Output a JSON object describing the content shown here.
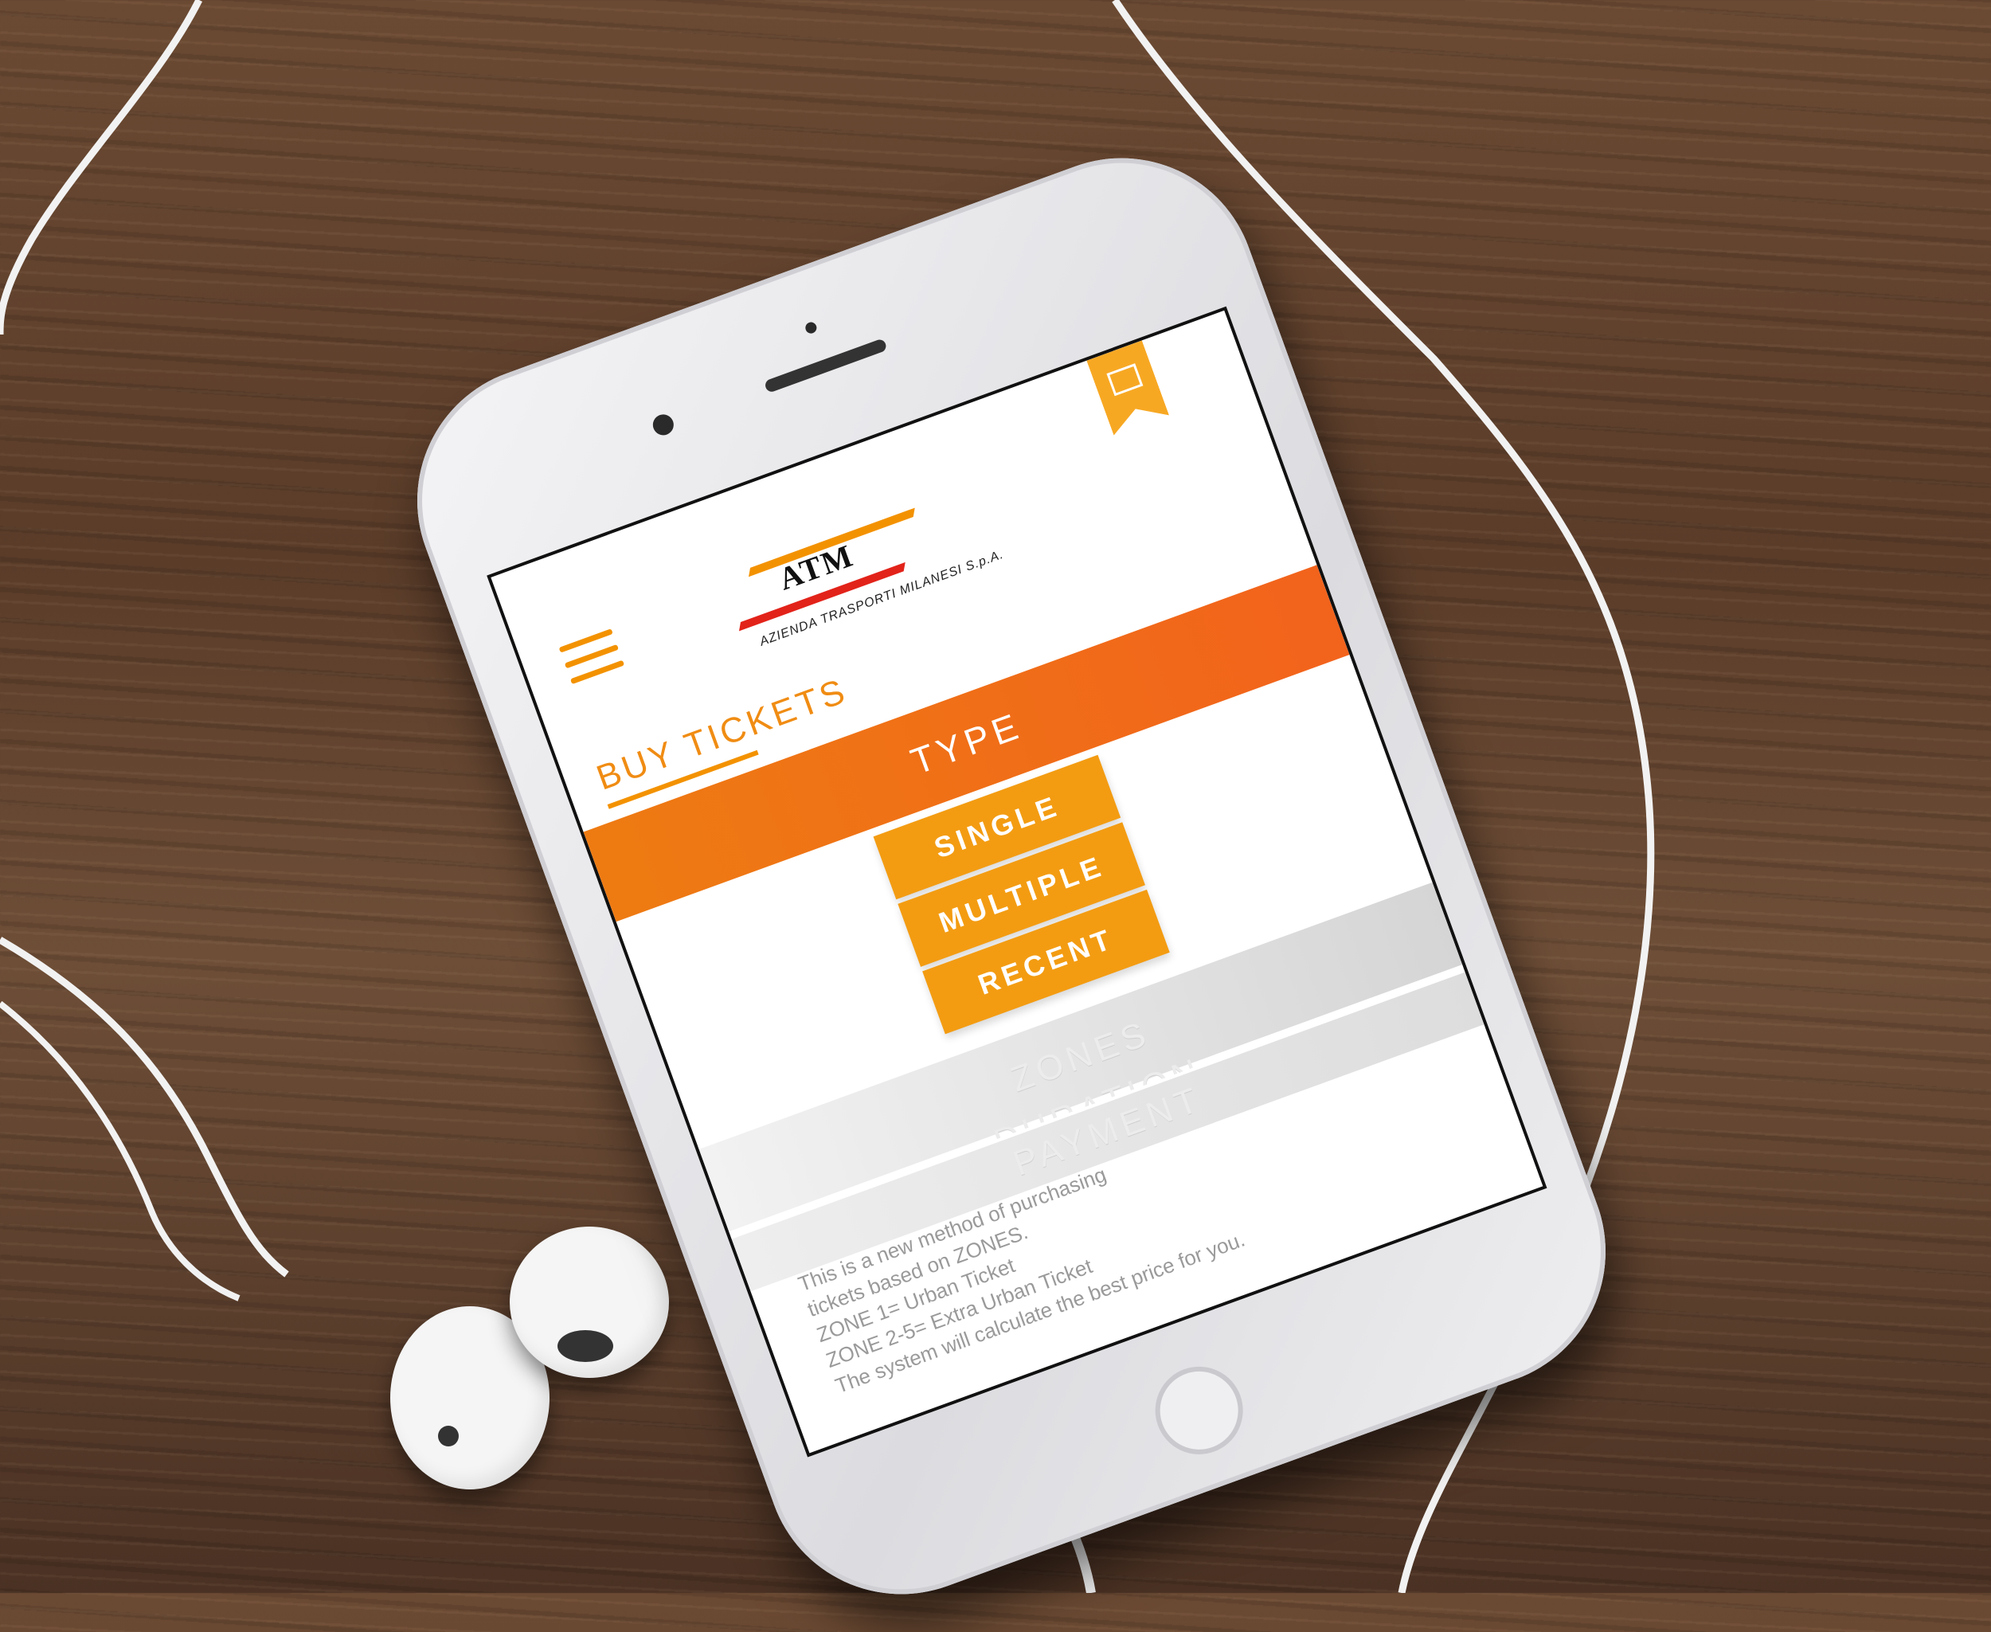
{
  "app": {
    "brand": "ATM",
    "brand_subtitle": "AZIENDA TRASPORTI MILANESI S.p.A."
  },
  "header": {
    "menu_icon": "hamburger-icon",
    "bookmark_icon": "map-bookmark-icon"
  },
  "page": {
    "title": "BUY TICKETS"
  },
  "steps": {
    "type_label": "TYPE",
    "options": [
      "SINGLE",
      "MULTIPLE",
      "RECENT"
    ],
    "inactive": [
      "ZONES",
      "DURATION",
      "PAYMENT"
    ]
  },
  "info": {
    "lines": [
      "This is a new method of purchasing",
      "tickets based on ZONES.",
      "ZONE 1= Urban Ticket",
      "ZONE 2-5= Extra Urban Ticket",
      "The system will calculate the best price for you."
    ]
  },
  "colors": {
    "accent": "#f39200",
    "band": "#ee7b12",
    "brand_red": "#e2231a",
    "inactive": "#e4e4e4"
  }
}
